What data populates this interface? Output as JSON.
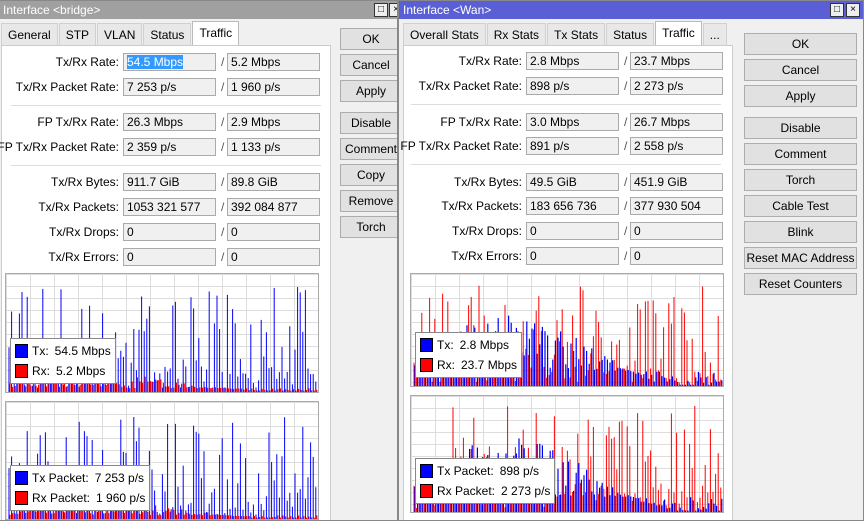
{
  "colors": {
    "tx": "#0000ff",
    "rx": "#ff0000",
    "title_active": "#5a5fd6",
    "title_inactive": "#a0a0a0"
  },
  "left": {
    "title": "Interface <bridge>",
    "tabs": [
      "General",
      "STP",
      "VLAN",
      "Status",
      "Traffic"
    ],
    "active_tab": "Traffic",
    "rows": [
      {
        "label": "Tx/Rx Rate:",
        "tx": "54.5 Mbps",
        "rx": "5.2 Mbps"
      },
      {
        "label": "Tx/Rx Packet Rate:",
        "tx": "7 253 p/s",
        "rx": "1 960 p/s"
      },
      {
        "label": "FP Tx/Rx Rate:",
        "tx": "26.3 Mbps",
        "rx": "2.9 Mbps"
      },
      {
        "label": "FP Tx/Rx Packet Rate:",
        "tx": "2 359 p/s",
        "rx": "1 133 p/s"
      },
      {
        "label": "Tx/Rx Bytes:",
        "tx": "911.7 GiB",
        "rx": "89.8 GiB"
      },
      {
        "label": "Tx/Rx Packets:",
        "tx": "1053 321 577",
        "rx": "392 084 877"
      },
      {
        "label": "Tx/Rx Drops:",
        "tx": "0",
        "rx": "0"
      },
      {
        "label": "Tx/Rx Errors:",
        "tx": "0",
        "rx": "0"
      }
    ],
    "buttons": [
      "OK",
      "Cancel",
      "Apply",
      "Disable",
      "Comment",
      "Copy",
      "Remove",
      "Torch"
    ],
    "graph1": {
      "tx_label": "Tx:",
      "tx_value": "54.5 Mbps",
      "rx_label": "Rx:",
      "rx_value": "5.2 Mbps"
    },
    "graph2": {
      "tx_label": "Tx Packet:",
      "tx_value": "7 253 p/s",
      "rx_label": "Rx Packet:",
      "rx_value": "1 960 p/s"
    }
  },
  "right": {
    "title": "Interface <Wan>",
    "tabs": [
      "Overall Stats",
      "Rx Stats",
      "Tx Stats",
      "Status",
      "Traffic",
      "..."
    ],
    "active_tab": "Traffic",
    "rows": [
      {
        "label": "Tx/Rx Rate:",
        "tx": "2.8 Mbps",
        "rx": "23.7 Mbps"
      },
      {
        "label": "Tx/Rx Packet Rate:",
        "tx": "898 p/s",
        "rx": "2 273 p/s"
      },
      {
        "label": "FP Tx/Rx Rate:",
        "tx": "3.0 Mbps",
        "rx": "26.7 Mbps"
      },
      {
        "label": "FP Tx/Rx Packet Rate:",
        "tx": "891 p/s",
        "rx": "2 558 p/s"
      },
      {
        "label": "Tx/Rx Bytes:",
        "tx": "49.5 GiB",
        "rx": "451.9 GiB"
      },
      {
        "label": "Tx/Rx Packets:",
        "tx": "183 656 736",
        "rx": "377 930 504"
      },
      {
        "label": "Tx/Rx Drops:",
        "tx": "0",
        "rx": "0"
      },
      {
        "label": "Tx/Rx Errors:",
        "tx": "0",
        "rx": "0"
      }
    ],
    "buttons": [
      "OK",
      "Cancel",
      "Apply",
      "Disable",
      "Comment",
      "Torch",
      "Cable Test",
      "Blink",
      "Reset MAC Address",
      "Reset Counters"
    ],
    "graph1": {
      "tx_label": "Tx:",
      "tx_value": "2.8 Mbps",
      "rx_label": "Rx:",
      "rx_value": "23.7 Mbps"
    },
    "graph2": {
      "tx_label": "Tx Packet:",
      "tx_value": "898 p/s",
      "rx_label": "Rx Packet:",
      "rx_value": "2 273 p/s"
    }
  }
}
